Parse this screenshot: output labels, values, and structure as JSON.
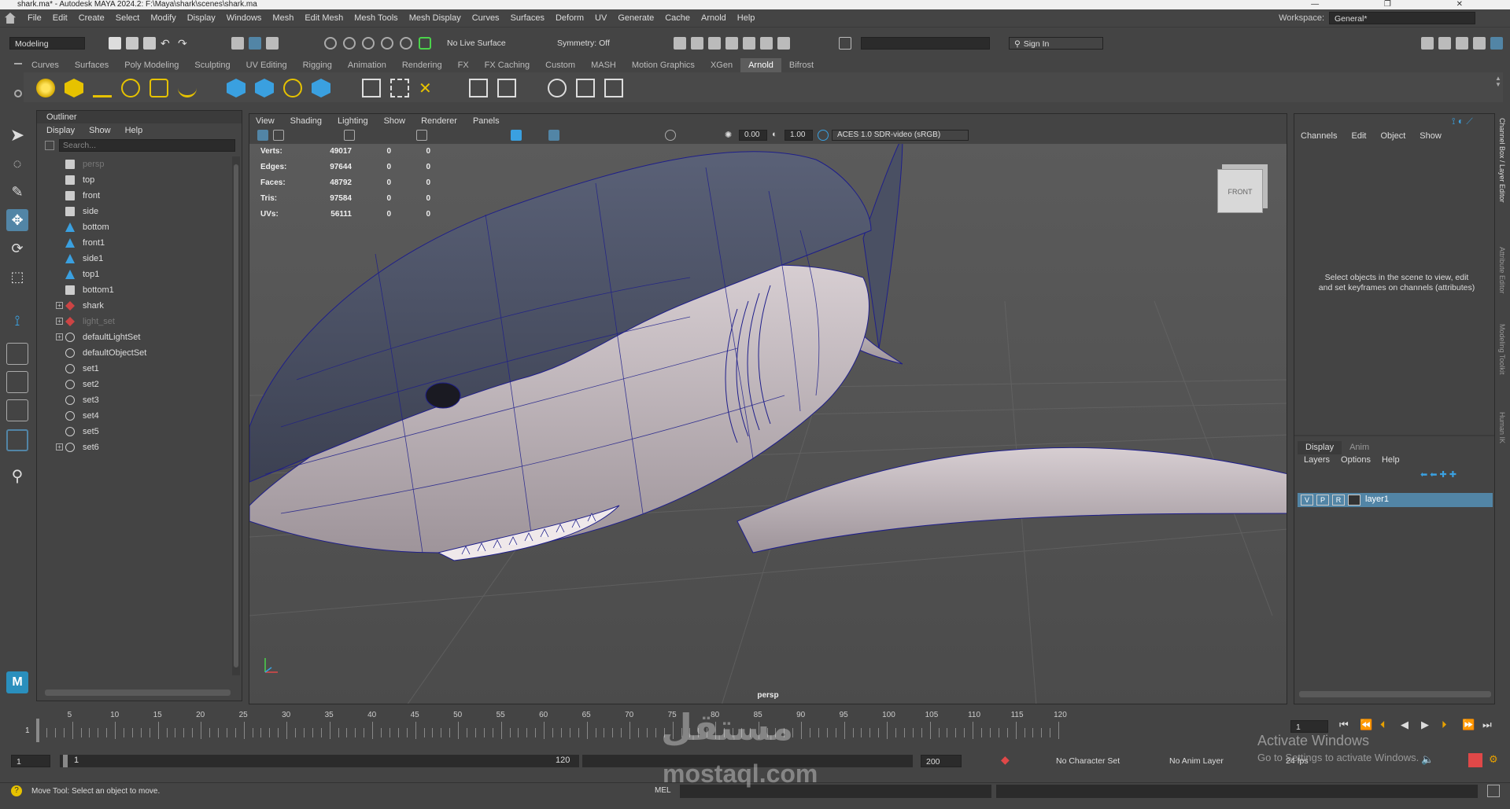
{
  "window": {
    "title": "shark.ma* - Autodesk MAYA 2024.2: F:\\Maya\\shark\\scenes\\shark.ma"
  },
  "menubar": {
    "items": [
      "File",
      "Edit",
      "Create",
      "Select",
      "Modify",
      "Display",
      "Windows",
      "Mesh",
      "Edit Mesh",
      "Mesh Tools",
      "Mesh Display",
      "Curves",
      "Surfaces",
      "Deform",
      "UV",
      "Generate",
      "Cache",
      "Arnold",
      "Help"
    ],
    "workspace_label": "Workspace:",
    "workspace_value": "General*"
  },
  "statusline": {
    "mode": "Modeling",
    "live_surface": "No Live Surface",
    "symmetry": "Symmetry: Off",
    "sign_in": "Sign In"
  },
  "shelf": {
    "tabs": [
      "Curves",
      "Surfaces",
      "Poly Modeling",
      "Sculpting",
      "UV Editing",
      "Rigging",
      "Animation",
      "Rendering",
      "FX",
      "FX Caching",
      "Custom",
      "MASH",
      "Motion Graphics",
      "XGen",
      "Arnold",
      "Bifrost"
    ],
    "active_tab": "Arnold"
  },
  "outliner": {
    "title": "Outliner",
    "menu": [
      "Display",
      "Show",
      "Help"
    ],
    "search_placeholder": "Search...",
    "items": [
      {
        "label": "persp",
        "icon": "camera-icon",
        "dim": true,
        "expandable": false
      },
      {
        "label": "top",
        "icon": "camera-icon",
        "dim": false,
        "expandable": false
      },
      {
        "label": "front",
        "icon": "camera-icon",
        "dim": false,
        "expandable": false
      },
      {
        "label": "side",
        "icon": "camera-icon",
        "dim": false,
        "expandable": false
      },
      {
        "label": "bottom",
        "icon": "camera-transform-icon",
        "dim": false,
        "expandable": false
      },
      {
        "label": "front1",
        "icon": "camera-transform-icon",
        "dim": false,
        "expandable": false
      },
      {
        "label": "side1",
        "icon": "camera-transform-icon",
        "dim": false,
        "expandable": false
      },
      {
        "label": "top1",
        "icon": "camera-transform-icon",
        "dim": false,
        "expandable": false
      },
      {
        "label": "bottom1",
        "icon": "camera-icon",
        "dim": false,
        "expandable": false
      },
      {
        "label": "shark",
        "icon": "mesh-group-icon",
        "dim": false,
        "expandable": true
      },
      {
        "label": "light_set",
        "icon": "mesh-group-icon",
        "dim": true,
        "expandable": true
      },
      {
        "label": "defaultLightSet",
        "icon": "set-icon",
        "dim": false,
        "expandable": true
      },
      {
        "label": "defaultObjectSet",
        "icon": "set-icon",
        "dim": false,
        "expandable": false
      },
      {
        "label": "set1",
        "icon": "set-icon",
        "dim": false,
        "expandable": false
      },
      {
        "label": "set2",
        "icon": "set-icon",
        "dim": false,
        "expandable": false
      },
      {
        "label": "set3",
        "icon": "set-icon",
        "dim": false,
        "expandable": false
      },
      {
        "label": "set4",
        "icon": "set-icon",
        "dim": false,
        "expandable": false
      },
      {
        "label": "set5",
        "icon": "set-icon",
        "dim": false,
        "expandable": false
      },
      {
        "label": "set6",
        "icon": "set-icon",
        "dim": false,
        "expandable": true
      }
    ]
  },
  "viewport": {
    "menu": [
      "View",
      "Shading",
      "Lighting",
      "Show",
      "Renderer",
      "Panels"
    ],
    "exposure": "0.00",
    "gamma": "1.00",
    "color_space": "ACES 1.0 SDR-video (sRGB)",
    "camera_label": "persp",
    "viewcube_label": "FRONT",
    "hud": [
      {
        "label": "Verts:",
        "v1": "49017",
        "v2": "0",
        "v3": "0"
      },
      {
        "label": "Edges:",
        "v1": "97644",
        "v2": "0",
        "v3": "0"
      },
      {
        "label": "Faces:",
        "v1": "48792",
        "v2": "0",
        "v3": "0"
      },
      {
        "label": "Tris:",
        "v1": "97584",
        "v2": "0",
        "v3": "0"
      },
      {
        "label": "UVs:",
        "v1": "56111",
        "v2": "0",
        "v3": "0"
      }
    ]
  },
  "channelbox": {
    "menu": [
      "Channels",
      "Edit",
      "Object",
      "Show"
    ],
    "message": "Select objects in the scene to view, edit and set keyframes on channels (attributes)",
    "layer_tabs": [
      "Display",
      "Anim"
    ],
    "layer_menu": [
      "Layers",
      "Options",
      "Help"
    ],
    "layer": {
      "v": "V",
      "p": "P",
      "r": "R",
      "name": "layer1"
    },
    "side_tabs": [
      "Channel Box / Layer Editor",
      "Attribute Editor",
      "Modeling Toolkit",
      "Human IK"
    ]
  },
  "timeline": {
    "ticks": [
      "5",
      "10",
      "15",
      "20",
      "25",
      "30",
      "35",
      "40",
      "45",
      "50",
      "55",
      "60",
      "65",
      "70",
      "75",
      "80",
      "85",
      "90",
      "95",
      "100",
      "105",
      "110",
      "115",
      "120"
    ],
    "first_frame_label": "1",
    "current_frame": "1"
  },
  "range": {
    "start": "1",
    "inner_start": "1",
    "inner_end": "120",
    "end": "200",
    "character_set": "No Character Set",
    "anim_layer": "No Anim Layer",
    "fps": "24 fps"
  },
  "cmdline": {
    "help_text": "Move Tool: Select an object to move.",
    "mode": "MEL"
  },
  "overlays": {
    "activate_title": "Activate Windows",
    "activate_sub": "Go to Settings to activate Windows.",
    "watermark_arabic": "مستقل",
    "watermark_latin": "mostaql.com"
  },
  "colors": {
    "selection": "#5285a6",
    "shark_top": "#4a5063",
    "shark_belly": "#bdb3b8",
    "wire": "#1e1e8a",
    "accent_yellow": "#e6c200",
    "accent_blue": "#3aa0e0"
  }
}
